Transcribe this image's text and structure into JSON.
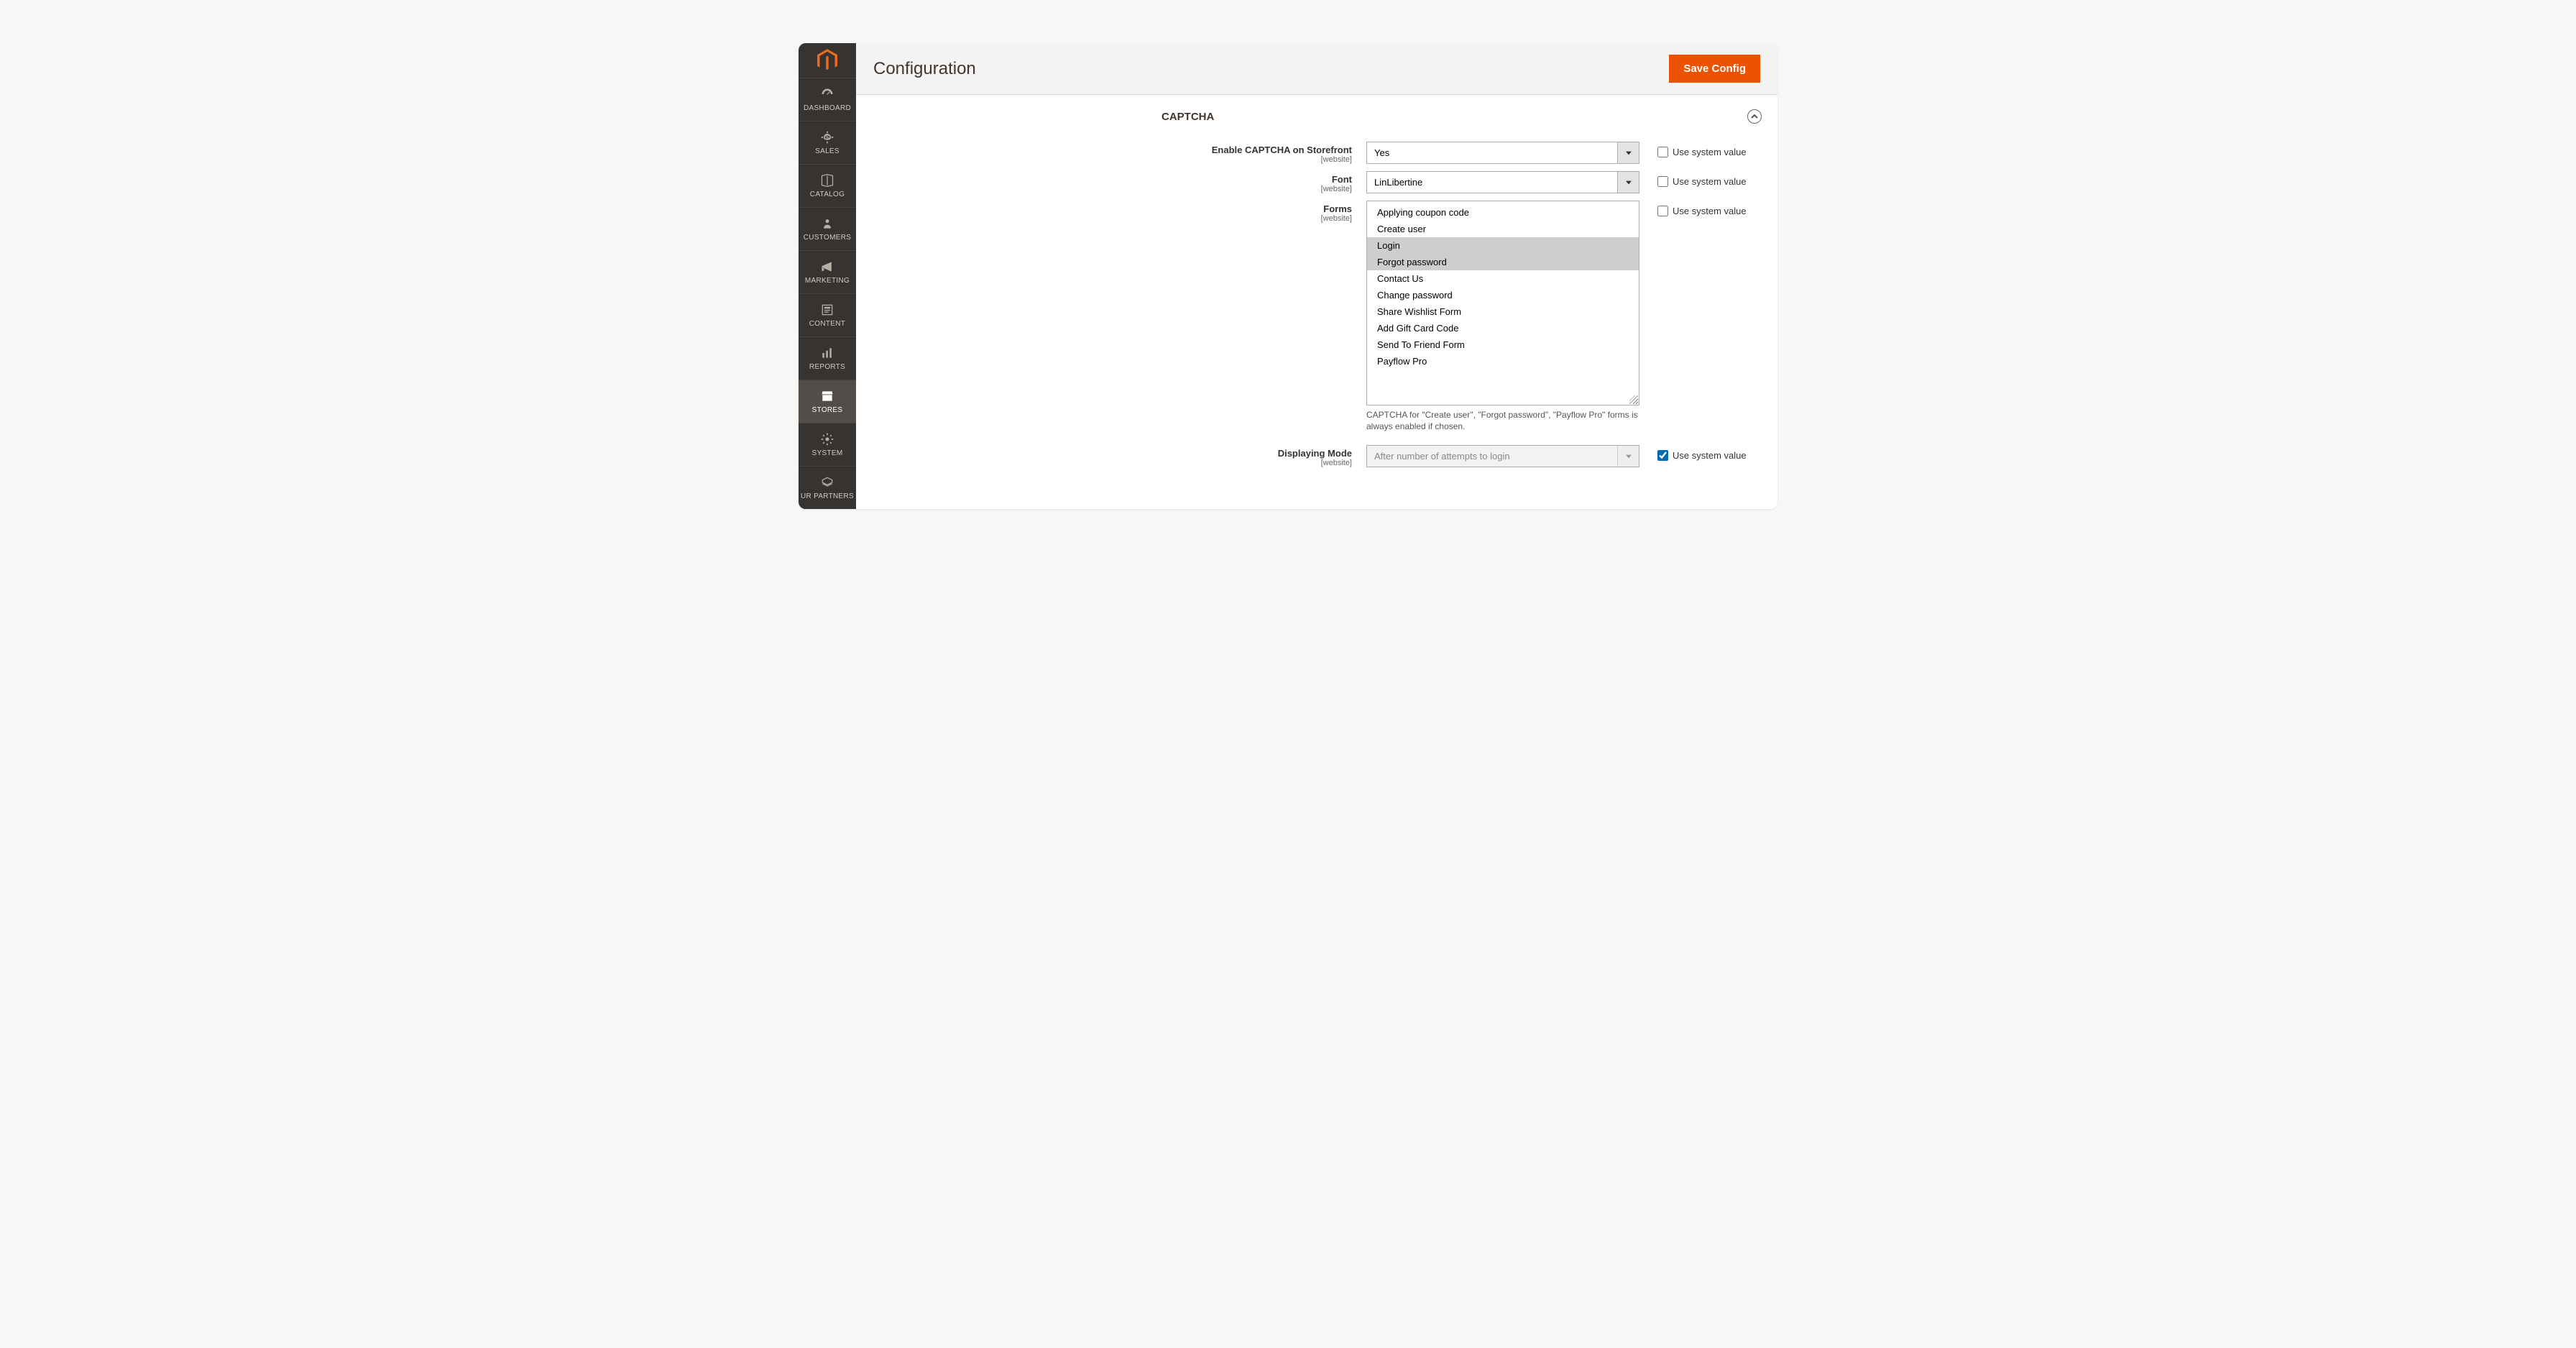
{
  "page": {
    "title": "Configuration",
    "save_button": "Save Config"
  },
  "sidebar": {
    "items": [
      {
        "id": "dashboard",
        "label": "DASHBOARD"
      },
      {
        "id": "sales",
        "label": "SALES"
      },
      {
        "id": "catalog",
        "label": "CATALOG"
      },
      {
        "id": "customers",
        "label": "CUSTOMERS"
      },
      {
        "id": "marketing",
        "label": "MARKETING"
      },
      {
        "id": "content",
        "label": "CONTENT"
      },
      {
        "id": "reports",
        "label": "REPORTS"
      },
      {
        "id": "stores",
        "label": "STORES",
        "active": true
      },
      {
        "id": "system",
        "label": "SYSTEM"
      },
      {
        "id": "partners",
        "label": "UR PARTNERS"
      }
    ]
  },
  "section": {
    "title": "CAPTCHA"
  },
  "system_value_label": "Use system value",
  "scope_label": "[website]",
  "fields": {
    "enable": {
      "label": "Enable CAPTCHA on Storefront",
      "value": "Yes",
      "use_system": false
    },
    "font": {
      "label": "Font",
      "value": "LinLibertine",
      "use_system": false
    },
    "forms": {
      "label": "Forms",
      "use_system": false,
      "options": [
        {
          "label": "Applying coupon code",
          "selected": false
        },
        {
          "label": "Create user",
          "selected": false
        },
        {
          "label": "Login",
          "selected": true
        },
        {
          "label": "Forgot password",
          "selected": true
        },
        {
          "label": "Contact Us",
          "selected": false
        },
        {
          "label": "Change password",
          "selected": false
        },
        {
          "label": "Share Wishlist Form",
          "selected": false
        },
        {
          "label": "Add Gift Card Code",
          "selected": false
        },
        {
          "label": "Send To Friend Form",
          "selected": false
        },
        {
          "label": "Payflow Pro",
          "selected": false
        }
      ],
      "help": "CAPTCHA for \"Create user\", \"Forgot password\", \"Payflow Pro\" forms is always enabled if chosen."
    },
    "mode": {
      "label": "Displaying Mode",
      "value": "After number of attempts to login",
      "use_system": true
    }
  }
}
